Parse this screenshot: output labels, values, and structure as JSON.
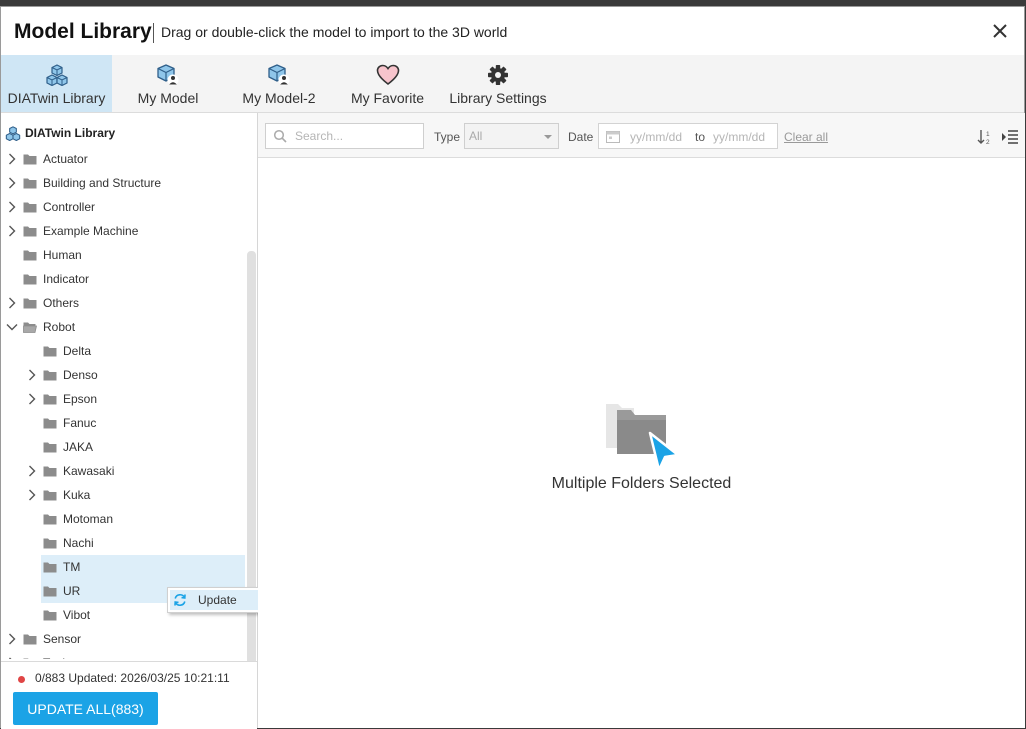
{
  "window": {
    "title": "Model Library",
    "subtitle": "Drag or double-click the model to import to the 3D world"
  },
  "tabs": [
    {
      "label": "DIATwin Library",
      "icon": "cubes-icon",
      "active": true
    },
    {
      "label": "My Model",
      "icon": "cube-user-icon"
    },
    {
      "label": "My Model-2",
      "icon": "cube-user-icon"
    },
    {
      "label": "My Favorite",
      "icon": "heart-icon"
    },
    {
      "label": "Library Settings",
      "icon": "gear-icon"
    }
  ],
  "tree": {
    "root": "DIATwin Library",
    "items": [
      {
        "label": "Actuator",
        "level": 0,
        "expand": "collapsed"
      },
      {
        "label": "Building and Structure",
        "level": 0,
        "expand": "collapsed"
      },
      {
        "label": "Controller",
        "level": 0,
        "expand": "collapsed"
      },
      {
        "label": "Example Machine",
        "level": 0,
        "expand": "collapsed"
      },
      {
        "label": "Human",
        "level": 0,
        "expand": "none"
      },
      {
        "label": "Indicator",
        "level": 0,
        "expand": "none"
      },
      {
        "label": "Others",
        "level": 0,
        "expand": "collapsed"
      },
      {
        "label": "Robot",
        "level": 0,
        "expand": "expanded"
      },
      {
        "label": "Delta",
        "level": 1,
        "expand": "none"
      },
      {
        "label": "Denso",
        "level": 1,
        "expand": "collapsed"
      },
      {
        "label": "Epson",
        "level": 1,
        "expand": "collapsed"
      },
      {
        "label": "Fanuc",
        "level": 1,
        "expand": "none"
      },
      {
        "label": "JAKA",
        "level": 1,
        "expand": "none"
      },
      {
        "label": "Kawasaki",
        "level": 1,
        "expand": "collapsed"
      },
      {
        "label": "Kuka",
        "level": 1,
        "expand": "collapsed"
      },
      {
        "label": "Motoman",
        "level": 1,
        "expand": "none"
      },
      {
        "label": "Nachi",
        "level": 1,
        "expand": "none"
      },
      {
        "label": "TM",
        "level": 1,
        "expand": "none",
        "selected": true
      },
      {
        "label": "UR",
        "level": 1,
        "expand": "none",
        "selected": true
      },
      {
        "label": "Vibot",
        "level": 1,
        "expand": "none"
      },
      {
        "label": "Sensor",
        "level": 0,
        "expand": "collapsed"
      },
      {
        "label": "Tool",
        "level": 0,
        "expand": "collapsed"
      }
    ]
  },
  "context_menu": {
    "label": "Update",
    "icon": "refresh-icon"
  },
  "status": {
    "text": "0/883 Updated: 2026/03/25 10:21:11",
    "dot_color": "#e04545"
  },
  "update_button": {
    "label": "UPDATE ALL(883)"
  },
  "filters": {
    "search_placeholder": "Search...",
    "type_label": "Type",
    "type_value": "All",
    "date_label": "Date",
    "date_from_placeholder": "yy/mm/dd",
    "date_to_label": "to",
    "date_to_placeholder": "yy/mm/dd",
    "clear_all": "Clear all"
  },
  "content": {
    "empty_text": "Multiple Folders Selected"
  },
  "colors": {
    "accent": "#1ba3e6",
    "selected_bg": "#ddeef9",
    "active_tab_bg": "#cfe6f5"
  }
}
